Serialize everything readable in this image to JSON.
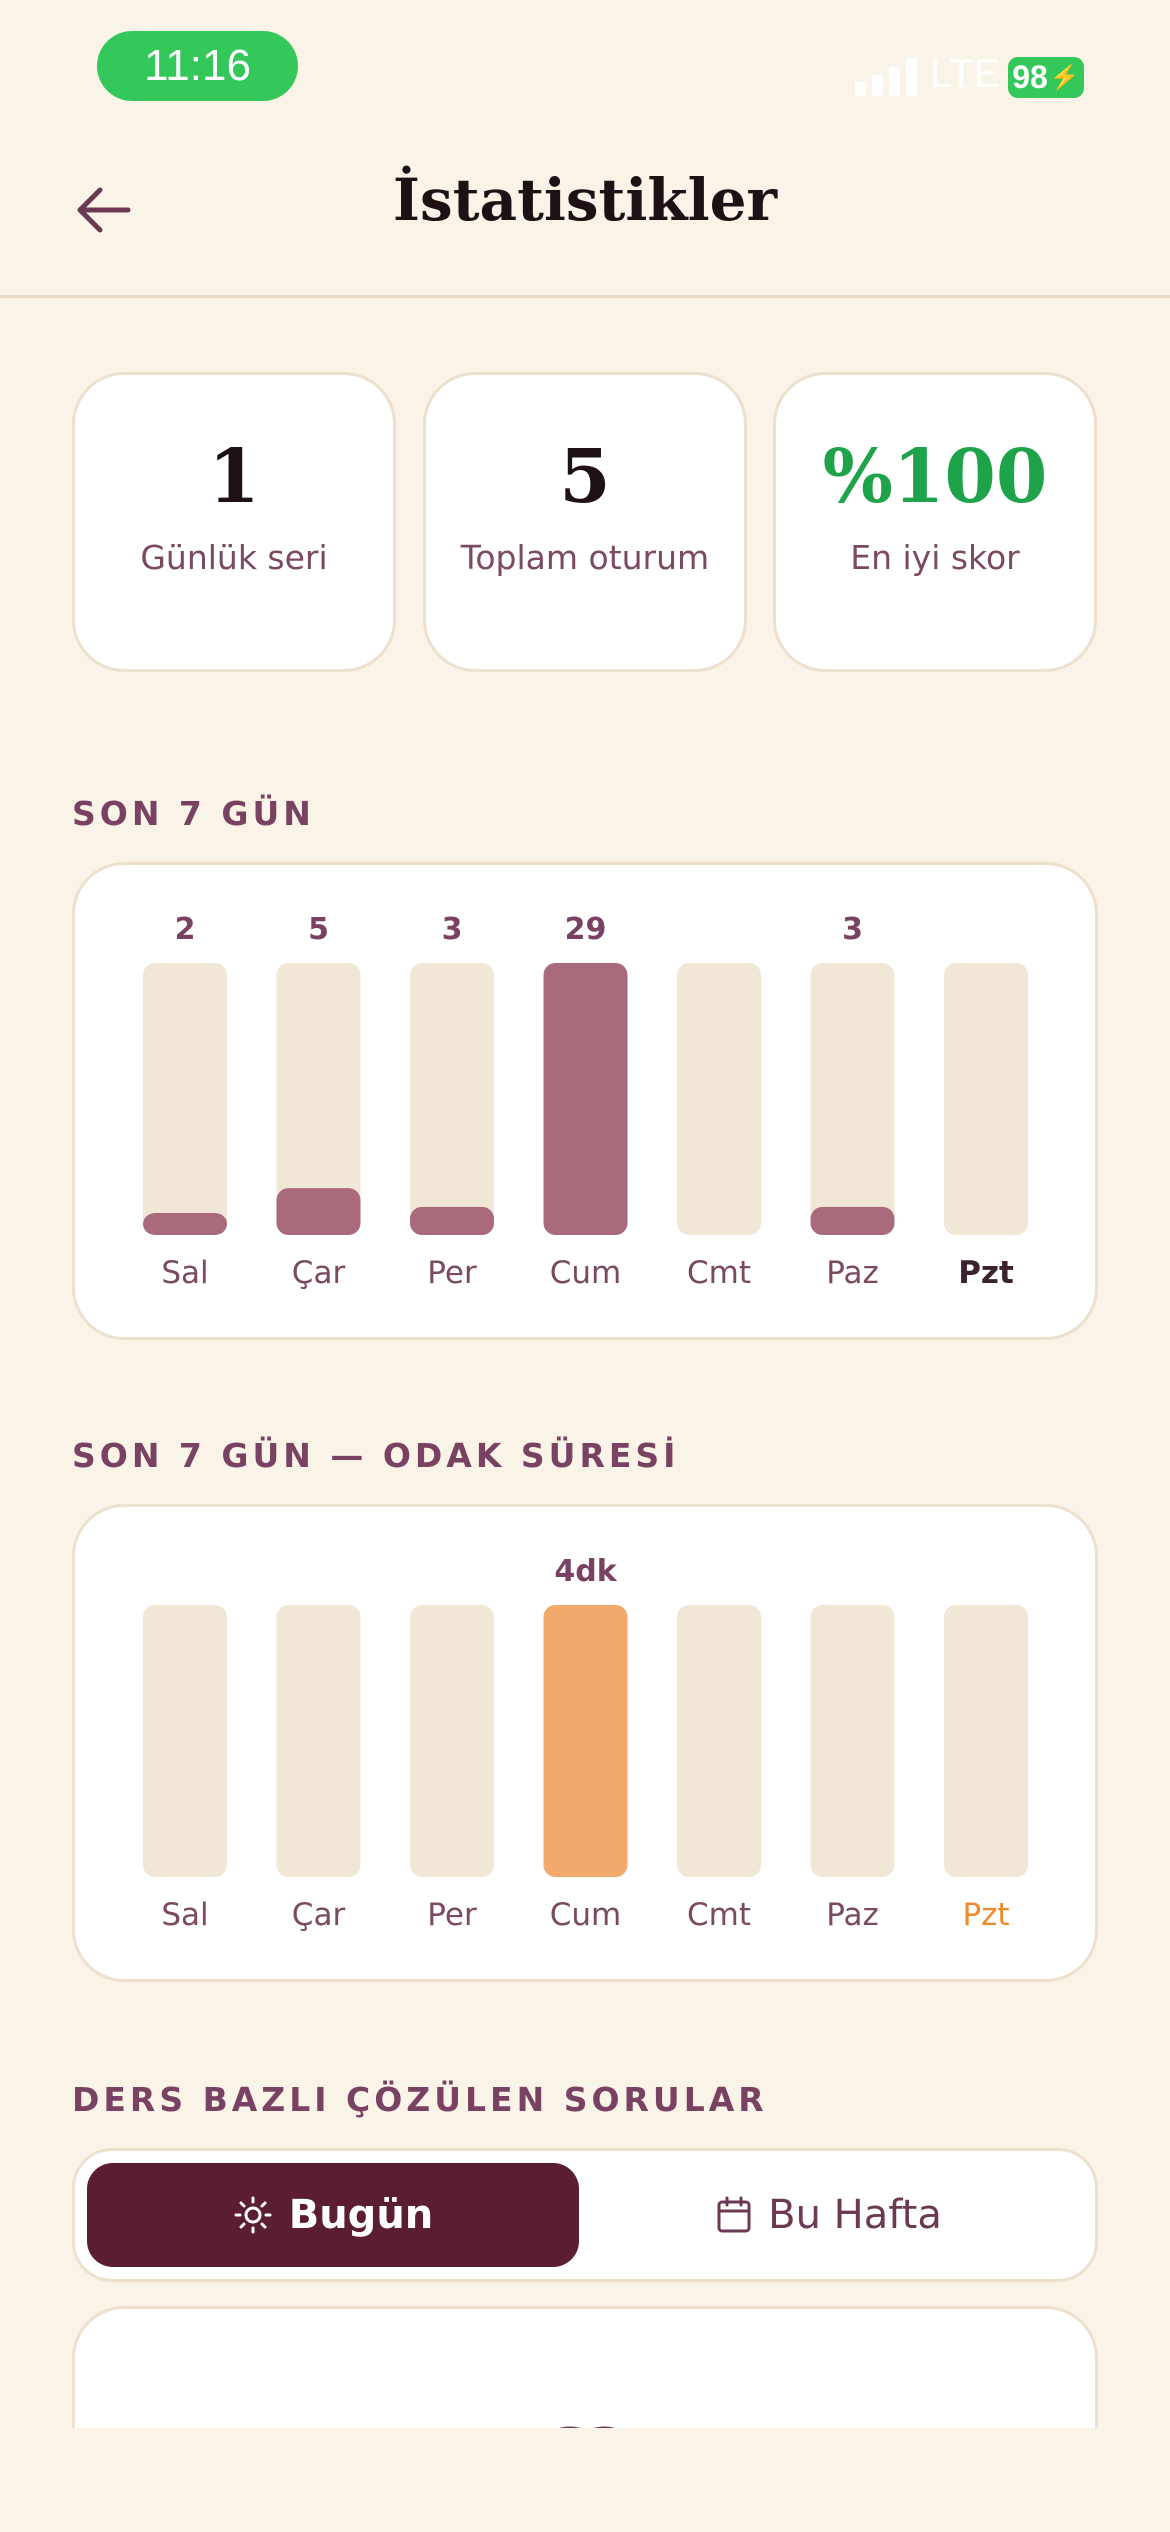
{
  "status_bar": {
    "time": "11:16",
    "network": "LTE",
    "battery": "98"
  },
  "header": {
    "title": "İstatistikler"
  },
  "stats": [
    {
      "value": "1",
      "label": "Günlük seri",
      "color": "#1E1116"
    },
    {
      "value": "5",
      "label": "Toplam oturum",
      "color": "#1E1116"
    },
    {
      "value": "%100",
      "label": "En iyi skor",
      "color": "#1FA34A"
    }
  ],
  "sections": {
    "sessions_title": "SON 7 GÜN",
    "focus_title": "SON 7 GÜN — ODAK SÜRESİ",
    "subjects_title": "DERS BAZLI ÇÖZÜLEN SORULAR"
  },
  "chart_data": [
    {
      "type": "bar",
      "categories": [
        "Sal",
        "Çar",
        "Per",
        "Cum",
        "Cmt",
        "Paz",
        "Pzt"
      ],
      "values": [
        2,
        5,
        3,
        29,
        0,
        3,
        0
      ],
      "value_labels": [
        "2",
        "5",
        "3",
        "29",
        "",
        "3",
        ""
      ],
      "ylim": [
        0,
        29
      ],
      "bar_color": "#A96B7B",
      "track_color": "#F0E7D6",
      "highlight_category": "Pzt",
      "highlight_color": "#3A2230"
    },
    {
      "type": "bar",
      "categories": [
        "Sal",
        "Çar",
        "Per",
        "Cum",
        "Cmt",
        "Paz",
        "Pzt"
      ],
      "values": [
        0,
        0,
        0,
        4,
        0,
        0,
        0
      ],
      "value_labels": [
        "",
        "",
        "",
        "4dk",
        "",
        "",
        ""
      ],
      "unit": "dk",
      "ylim": [
        0,
        4
      ],
      "bar_color": "#F2AA6C",
      "track_color": "#F0E7D6",
      "highlight_category": "Pzt",
      "highlight_color": "#F08A2C"
    }
  ],
  "segment": {
    "today_label": "Bugün",
    "week_label": "Bu Hafta",
    "today_icon": "sun-icon",
    "week_icon": "calendar-icon"
  },
  "bottom_card": {
    "icon": "book-icon"
  }
}
